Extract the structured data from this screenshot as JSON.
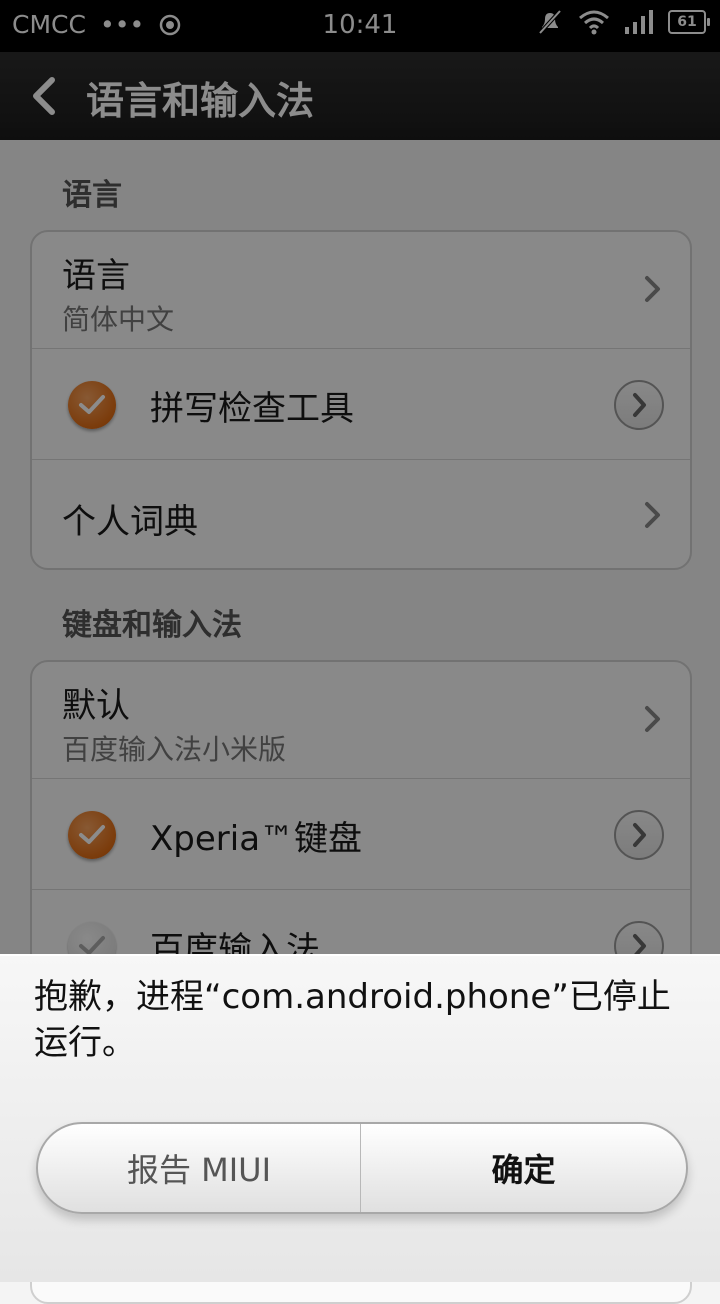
{
  "status_bar": {
    "carrier": "CMCC",
    "dots": "•••",
    "time": "10:41",
    "battery": "61",
    "icons": [
      "sync-icon",
      "muted-bell-icon",
      "wifi-icon",
      "signal-icon",
      "battery-icon"
    ]
  },
  "title_bar": {
    "title": "语言和输入法",
    "back_icon": "back-chevron-icon"
  },
  "sections": {
    "language_header": "语言",
    "language": {
      "title": "语言",
      "value": "简体中文"
    },
    "spellcheck": {
      "label": "拼写检查工具",
      "checked": true
    },
    "dictionary": {
      "label": "个人词典"
    },
    "keyboard_header": "键盘和输入法",
    "default": {
      "title": "默认",
      "value": "百度输入法小米版"
    },
    "xperia": {
      "label": "Xperia™键盘",
      "checked": true
    },
    "baidu": {
      "label": "百度输入法",
      "checked": false
    }
  },
  "dialog": {
    "message": "抱歉，进程“com.android.phone”已停止运行。",
    "report_button": "报告 MIUI",
    "ok_button": "确定"
  },
  "colors": {
    "accent_orange": "#e06d15",
    "title_bar": "#1b1b1b",
    "background": "#f2f2f2"
  }
}
